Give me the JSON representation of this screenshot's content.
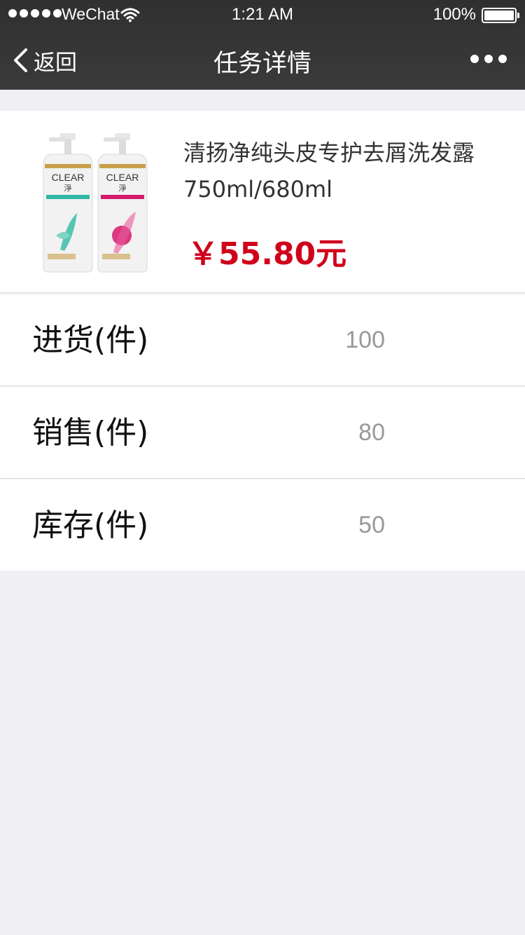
{
  "status_bar": {
    "carrier": "WeChat",
    "time": "1:21 AM",
    "battery": "100%",
    "battery_level": 1.0
  },
  "nav": {
    "back_label": "返回",
    "title": "任务详情",
    "more_icon": "more-dots-icon"
  },
  "product": {
    "name": "清扬净纯头皮专护去屑洗发露750ml/680ml",
    "price": "￥55.80元",
    "bottle_brand": "CLEAR",
    "bottle_brand_cn": "淨",
    "colors": {
      "price": "#d0021b",
      "bottle_left_accent": "#2fb9a4",
      "bottle_right_accent": "#d6196f"
    }
  },
  "stats": [
    {
      "label": "进货(件)",
      "value": "100"
    },
    {
      "label": "销售(件)",
      "value": "80"
    },
    {
      "label": "库存(件)",
      "value": "50"
    }
  ]
}
